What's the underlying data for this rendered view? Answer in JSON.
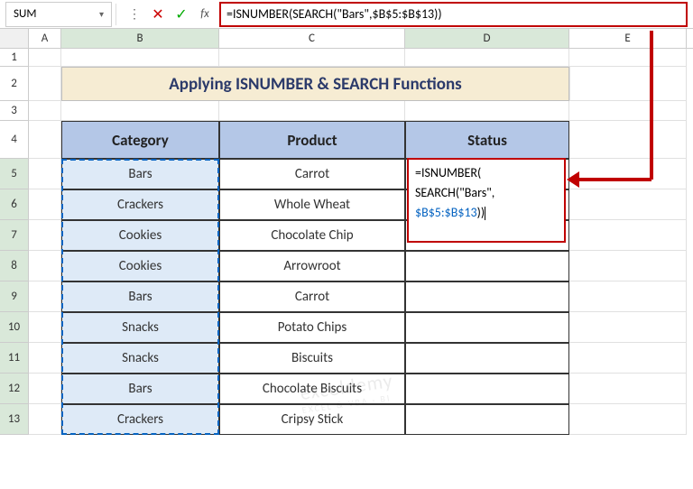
{
  "nameBox": "SUM",
  "formulaBar": "=ISNUMBER(SEARCH(\"Bars\",$B$5:$B$13))",
  "columns": [
    "A",
    "B",
    "C",
    "D",
    "E"
  ],
  "rows": [
    "1",
    "2",
    "3",
    "4",
    "5",
    "6",
    "7",
    "8",
    "9",
    "10",
    "11",
    "12",
    "13"
  ],
  "title": "Applying ISNUMBER & SEARCH Functions",
  "headers": {
    "b": "Category",
    "c": "Product",
    "d": "Status"
  },
  "data": [
    {
      "b": "Bars",
      "c": "Carrot"
    },
    {
      "b": "Crackers",
      "c": "Whole Wheat"
    },
    {
      "b": "Cookies",
      "c": "Chocolate Chip"
    },
    {
      "b": "Cookies",
      "c": "Arrowroot"
    },
    {
      "b": "Bars",
      "c": "Carrot"
    },
    {
      "b": "Snacks",
      "c": "Potato Chips"
    },
    {
      "b": "Snacks",
      "c": "Biscuits"
    },
    {
      "b": "Bars",
      "c": "Chocolate Biscuits"
    },
    {
      "b": "Crackers",
      "c": "Cripsy Stick"
    }
  ],
  "floatFormula": {
    "l1": "=ISNUMBER(",
    "l2": "SEARCH(\"Bars\",",
    "l3": "$B$5:$B$13",
    "l3tail": "))"
  },
  "watermark": "exceldemy",
  "watermarkSub": "EXCEL & VBA · BI"
}
